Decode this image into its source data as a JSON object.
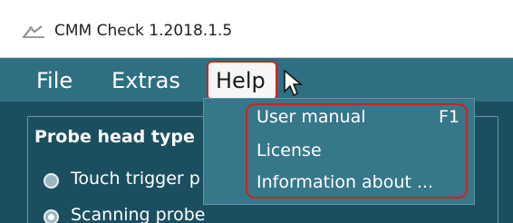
{
  "window": {
    "title": "CMM Check 1.2018.1.5",
    "icon": "cmm-machine-icon"
  },
  "menubar": {
    "items": [
      {
        "label": "File"
      },
      {
        "label": "Extras"
      },
      {
        "label": "Help"
      }
    ]
  },
  "help_menu": {
    "items": [
      {
        "label": "User manual",
        "shortcut": "F1"
      },
      {
        "label": "License",
        "shortcut": ""
      },
      {
        "label": "Information about ...",
        "shortcut": ""
      }
    ]
  },
  "panel": {
    "title": "Probe head type",
    "options": [
      {
        "label": "Touch trigger p",
        "selected": false
      },
      {
        "label": "Scanning probe",
        "selected": true
      }
    ]
  },
  "colors": {
    "menubar_bg": "#2f6f82",
    "content_bg": "#1b4f60",
    "highlight_red": "#d61f1f",
    "dropdown_bg": "#36778a"
  },
  "icons": {
    "cursor": "mouse-pointer-icon",
    "radio": "radio-button-icon"
  }
}
